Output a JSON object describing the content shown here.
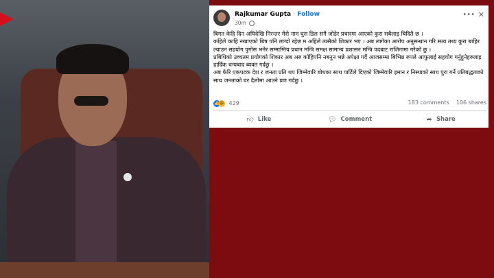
{
  "post": {
    "author": "Rajkumar Gupta",
    "separator": "·",
    "follow_label": "Follow",
    "time": "30m",
    "body": [
      "बिगत केहि दिन अघिदेखि निरन्तर मेरो नाम घुस डिल सगै जोडेर प्रचारमा आएको कुरा सबैलाइ बिदितै छ ।",
      " कहिले काहि नखाएको बिष पनि लाग्दो रहेछ म अहिले त्यसैको शिकार भए । अब लागेका आरोप अनुसन्धान गरि सत्य तथ्य कुरा बाहिर ल्याउन सहयोग पुगोस भनेर सम्माग्निय प्रधान मन्त्रि समक्ष सामान्य प्रशासन मन्त्रि पदबाट राजिनामा गरेको छु ।",
      " प्रबिधिको उच्चतम प्रयोगको शिकार अब अरु कोहिपनि नबनुन भन्ने अपेक्षा गर्दै आजसम्मा बिभिन्न रुपले आफुलाई सहयोग गर्नुहुनेहरुलाइ हार्दिक धन्यबाद ब्यक्त गर्दछु ।",
      " अब फेरि एकपटक देश र जनता प्रति थप जिम्मेवारि बोधका साथ पार्टिले दिएको जिम्मेवारि इमान र निस्थाको साथ पुरा गर्ने प्रतिबद्धताको साथ जनताको घर दैलोमा आउने प्रण गर्दछु ।"
    ],
    "reaction_count": "429",
    "comments": "183 comments",
    "shares": "106 shares",
    "actions": {
      "like": "Like",
      "comment": "Comment",
      "share": "Share"
    },
    "more_icon": "more-horizontal-icon",
    "close_icon": "close-icon"
  },
  "colors": {
    "background": "#7d0c10",
    "accent": "#1877f2"
  }
}
